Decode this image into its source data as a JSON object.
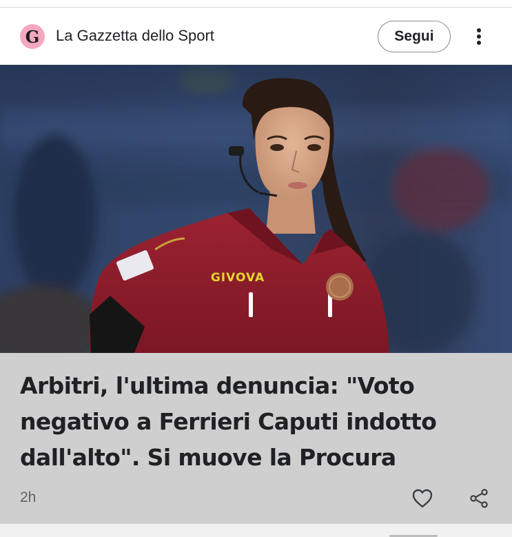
{
  "source": {
    "logo_letter": "G",
    "name": "La Gazzetta dello Sport"
  },
  "header": {
    "follow_label": "Segui",
    "more_icon": "more-vertical-icon"
  },
  "article": {
    "image_alt": "Foto: arbitro in maglia rossa GIVOVA",
    "jersey_brand": "GIVOVA",
    "headline": "Arbitri, l'ultima denuncia: \"Voto negativo a Ferrieri Caputi indotto dall'alto\". Si muove la Procura",
    "age": "2h"
  },
  "actions": {
    "like_icon": "heart-icon",
    "share_icon": "share-icon"
  },
  "colors": {
    "logo_bg": "#f5a7be",
    "card_bg": "#cfcfcf",
    "text_primary": "#202124",
    "text_secondary": "#5f6368",
    "jersey_red": "#8e1b2a",
    "jersey_brand": "#e4d530"
  }
}
